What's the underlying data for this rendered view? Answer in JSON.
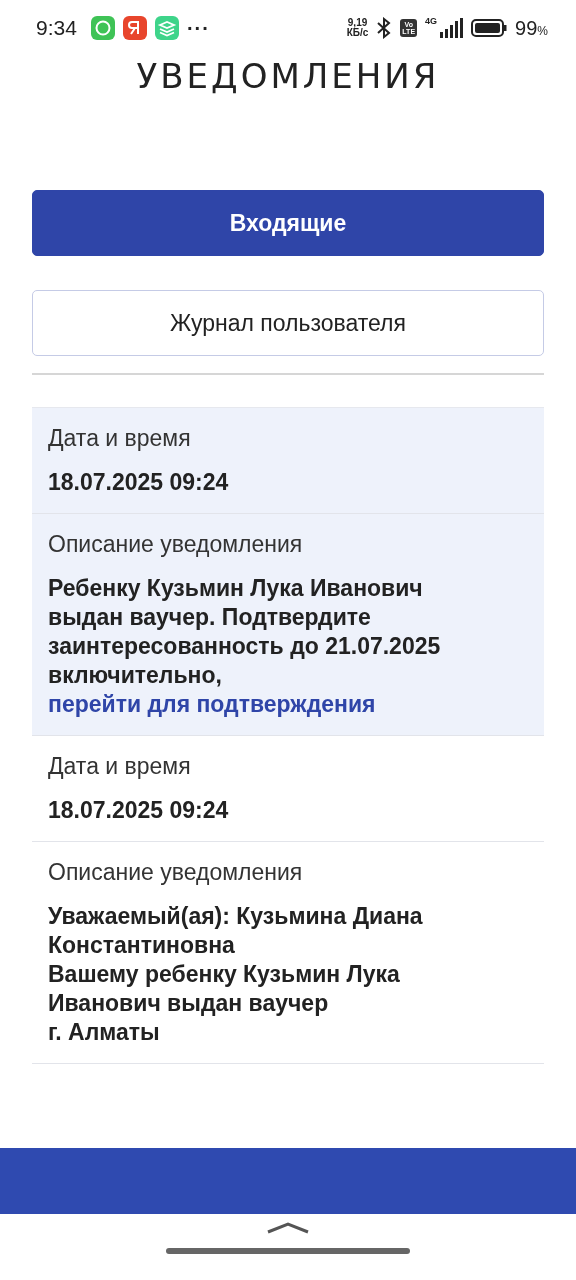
{
  "status_bar": {
    "time": "9:34",
    "more": "···",
    "speed": "9,19\nКБ/с",
    "volte": "Vo\nLTE",
    "network": "4G",
    "battery": "99",
    "battery_unit": "%"
  },
  "page": {
    "title": "УВЕДОМЛЕНИЯ"
  },
  "tabs": [
    {
      "label": "Входящие",
      "selected": true
    },
    {
      "label": "Журнал пользователя",
      "selected": false
    }
  ],
  "notifications": [
    {
      "highlighted": true,
      "date_label": "Дата и время",
      "date": "18.07.2025 09:24",
      "description_label": "Описание уведомления",
      "description": "Ребенку Кузьмин Лука Иванович выдан ваучер. Подтвердите заинтересованность до 21.07.2025 включительно,",
      "link": "перейти для подтверждения"
    },
    {
      "highlighted": false,
      "date_label": "Дата и время",
      "date": "18.07.2025 09:24",
      "description_label": "Описание уведомления",
      "description": "Уважаемый(ая): Кузьмина Диана Константиновна\nВашему ребенку Кузьмин Лука Иванович выдан ваучер\nг. Алматы"
    }
  ]
}
